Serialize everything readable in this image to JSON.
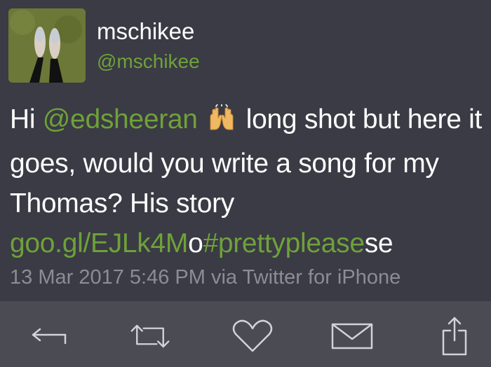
{
  "user": {
    "display_name": "mschikee",
    "handle": "@mschikee"
  },
  "tweet": {
    "part1": "Hi ",
    "mention": "@edsheeran",
    "emoji": "raising-hands",
    "part2": " long shot but here it goes, would you write a song for my Thomas? His story ",
    "link_a": "goo.gl/EJLk4M",
    "mid": "o",
    "hashtag": "#prettyplease",
    "tail": "se"
  },
  "meta": {
    "timestamp": "13 Mar 2017 5:46 PM",
    "via": " via Twitter for iPhone"
  },
  "actions": [
    {
      "name": "reply",
      "icon": "reply-arrow-icon"
    },
    {
      "name": "retweet",
      "icon": "retweet-icon"
    },
    {
      "name": "favorite",
      "icon": "heart-icon"
    },
    {
      "name": "message",
      "icon": "envelope-icon"
    },
    {
      "name": "share",
      "icon": "share-icon"
    }
  ],
  "colors": {
    "background": "#3a3b44",
    "accent_green": "#6fa13a",
    "meta_gray": "#8b8d96",
    "actionbar": "#4a4b53"
  }
}
